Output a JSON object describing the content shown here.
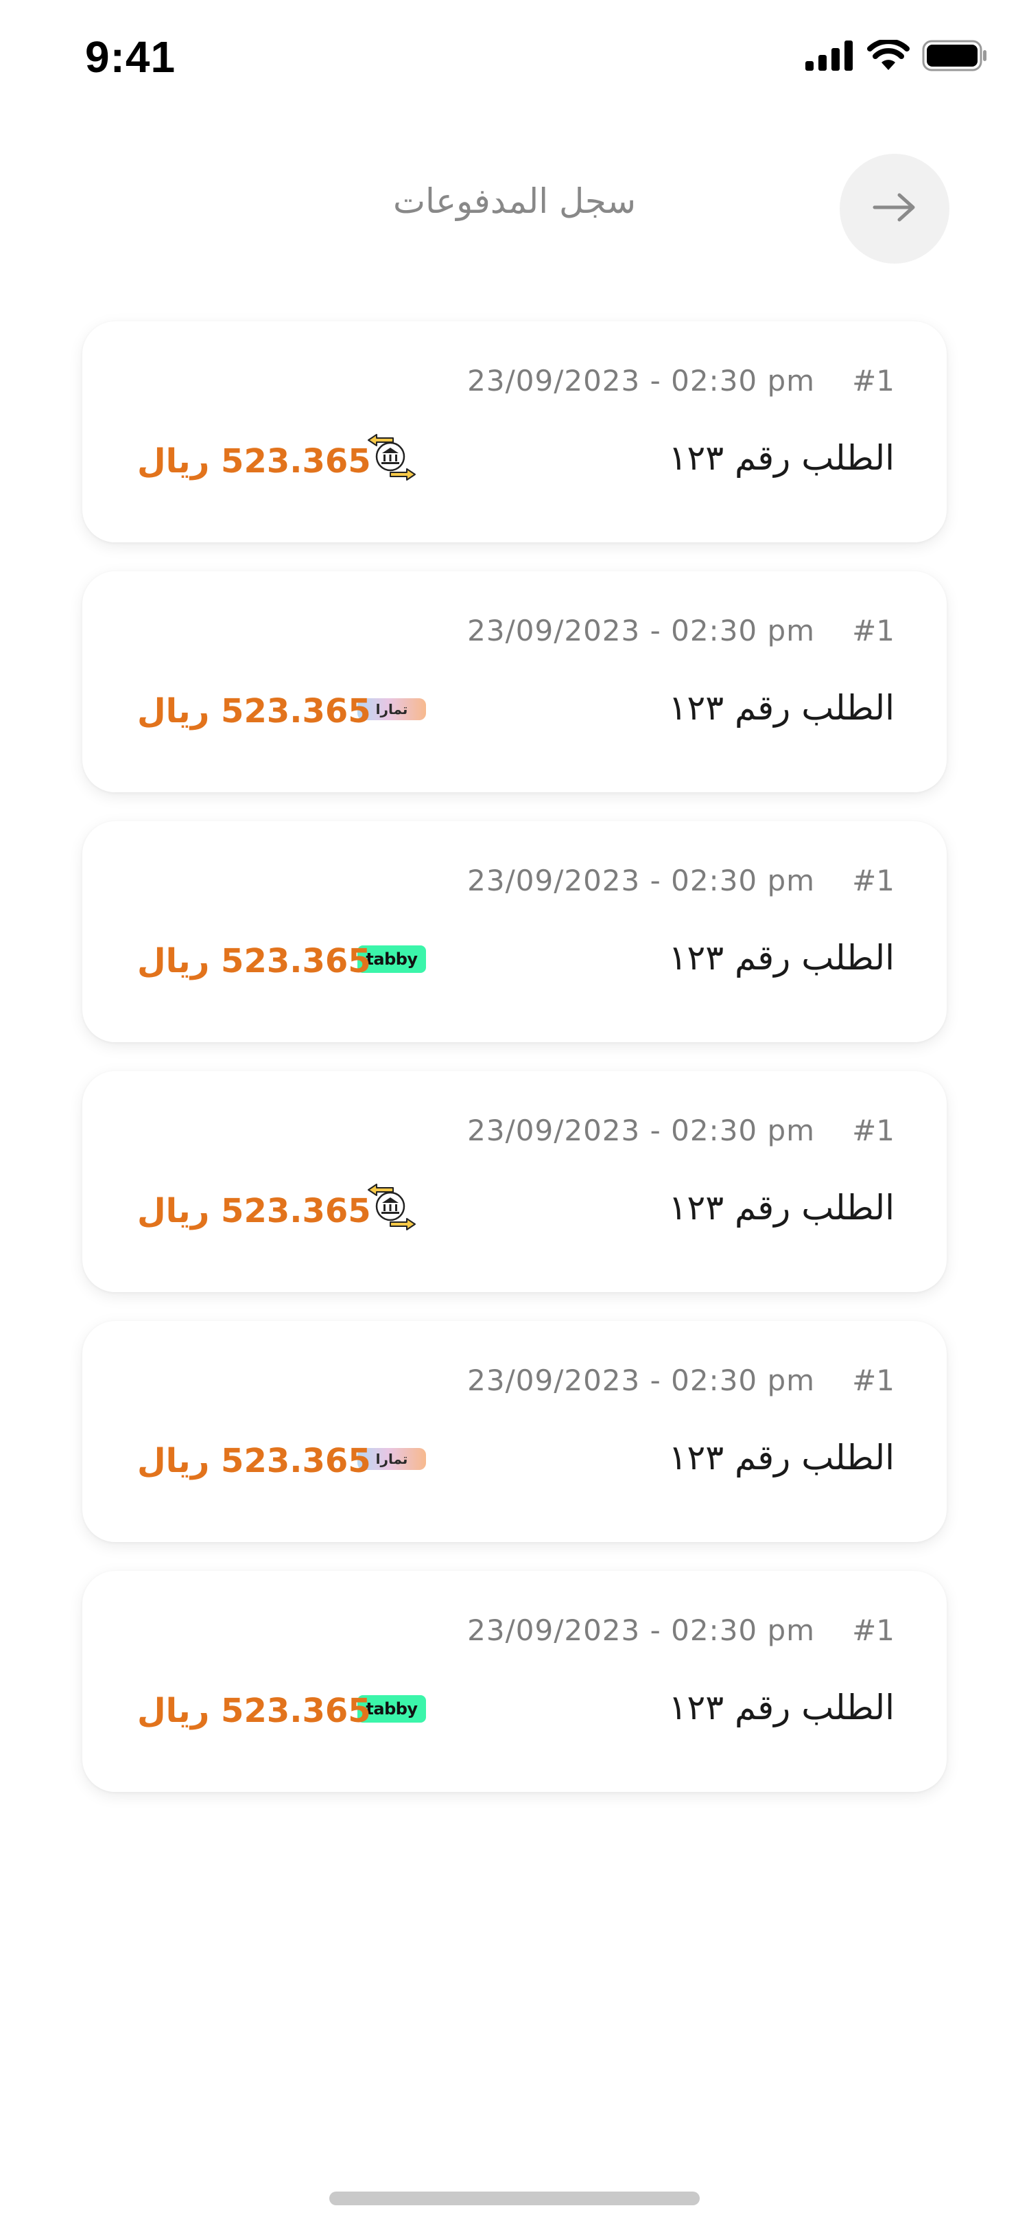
{
  "status_bar": {
    "time": "9:41",
    "icons": [
      "signal-icon",
      "wifi-icon",
      "battery-icon"
    ]
  },
  "header": {
    "title": "سجل المدفوعات",
    "back_icon": "arrow-right-icon"
  },
  "colors": {
    "amount": "#e2731c",
    "muted_text": "#7d7d7d",
    "title_text": "#888888",
    "tabby_green": "#3bf5aa"
  },
  "payments": [
    {
      "index": "#1",
      "datetime": "23/09/2023 - 02:30 pm",
      "order": "الطلب رقم ١٢٣",
      "amount": "523.365 ريال",
      "method": "bank-transfer-icon"
    },
    {
      "index": "#1",
      "datetime": "23/09/2023 - 02:30 pm",
      "order": "الطلب رقم ١٢٣",
      "amount": "523.365 ريال",
      "method": "tamara-logo",
      "method_label": "تمارا"
    },
    {
      "index": "#1",
      "datetime": "23/09/2023 - 02:30 pm",
      "order": "الطلب رقم ١٢٣",
      "amount": "523.365 ريال",
      "method": "tabby-logo",
      "method_label": "tabby"
    },
    {
      "index": "#1",
      "datetime": "23/09/2023 - 02:30 pm",
      "order": "الطلب رقم ١٢٣",
      "amount": "523.365 ريال",
      "method": "bank-transfer-icon"
    },
    {
      "index": "#1",
      "datetime": "23/09/2023 - 02:30 pm",
      "order": "الطلب رقم ١٢٣",
      "amount": "523.365 ريال",
      "method": "tamara-logo",
      "method_label": "تمارا"
    },
    {
      "index": "#1",
      "datetime": "23/09/2023 - 02:30 pm",
      "order": "الطلب رقم ١٢٣",
      "amount": "523.365 ريال",
      "method": "tabby-logo",
      "method_label": "tabby"
    }
  ]
}
